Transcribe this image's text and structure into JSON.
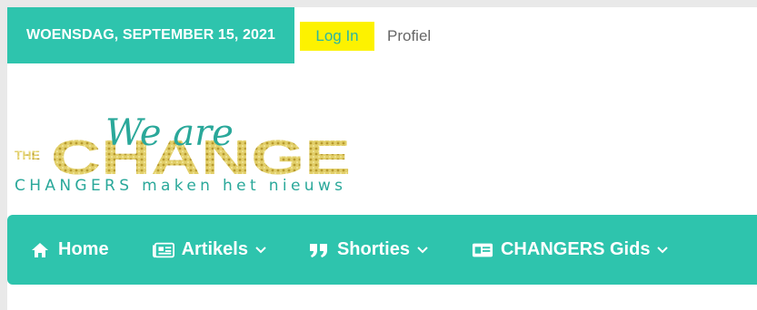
{
  "topbar": {
    "date": "WOENSDAG, SEPTEMBER 15, 2021",
    "login_label": "Log In",
    "profile_label": "Profiel"
  },
  "logo": {
    "script_text": "We are",
    "the_text": "THE",
    "main_text": "CHANGE",
    "tagline": "CHANGERS maken het nieuws",
    "colors": {
      "teal": "#2aa89a",
      "gold": "#d8c45a"
    }
  },
  "nav": {
    "items": [
      {
        "label": "Home",
        "icon": "home-icon",
        "dropdown": false
      },
      {
        "label": "Artikels",
        "icon": "newspaper-icon",
        "dropdown": true
      },
      {
        "label": "Shorties",
        "icon": "quote-icon",
        "dropdown": true
      },
      {
        "label": "CHANGERS Gids",
        "icon": "id-card-icon",
        "dropdown": true
      }
    ]
  },
  "colors": {
    "accent": "#2ec4ad",
    "highlight": "#fdf200",
    "text_on_accent": "#ffffff"
  }
}
